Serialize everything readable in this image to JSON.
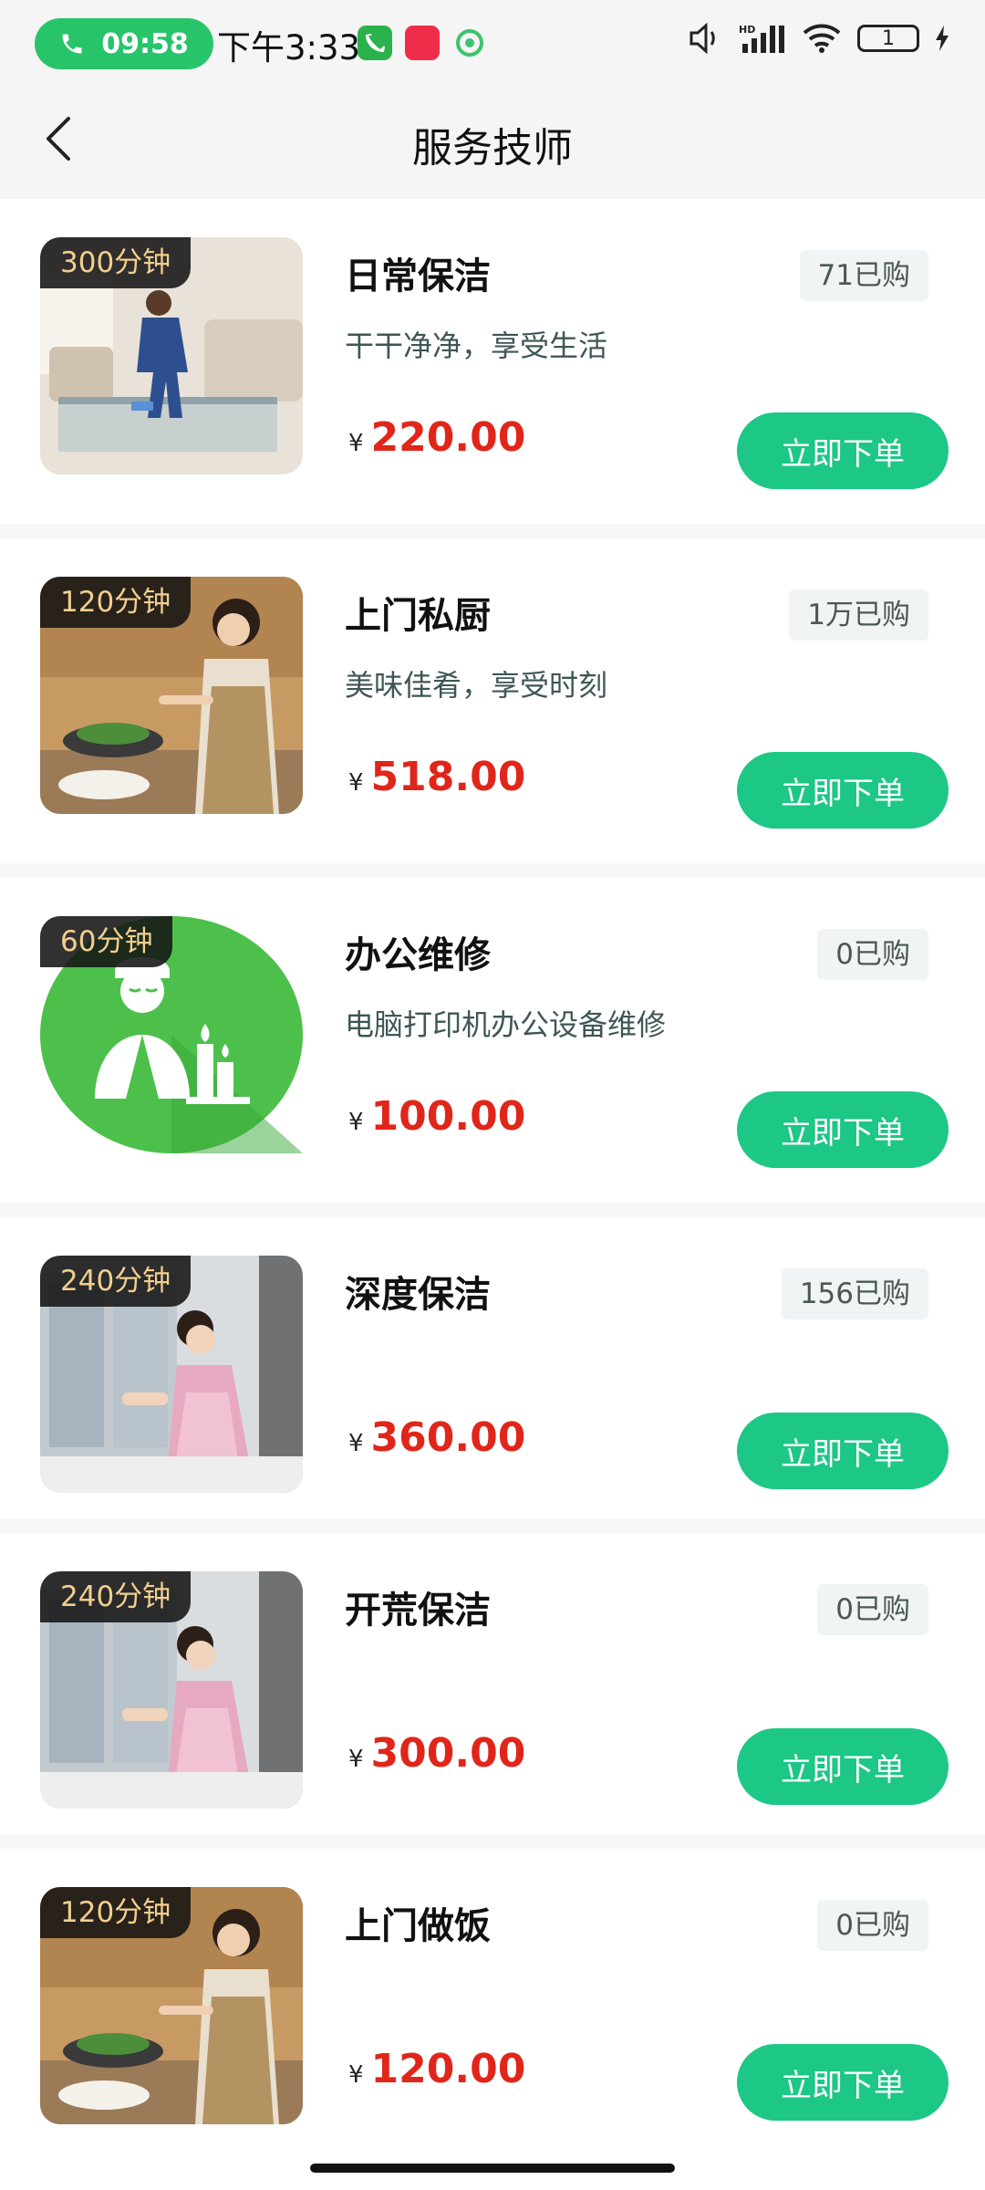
{
  "status_bar": {
    "call_time": "09:58",
    "clock": "下午3:33",
    "battery": "1",
    "network": "HD"
  },
  "header": {
    "title": "服务技师"
  },
  "currency_symbol": "¥",
  "items": [
    {
      "duration": "300分钟",
      "title": "日常保洁",
      "desc": "干干净净，享受生活",
      "sold": "71已购",
      "price": "220.00",
      "button": "立即下单",
      "image": "cleaning-photo"
    },
    {
      "duration": "120分钟",
      "title": "上门私厨",
      "desc": "美味佳肴，享受时刻",
      "sold": "1万已购",
      "price": "518.00",
      "button": "立即下单",
      "image": "cooking-photo"
    },
    {
      "duration": "60分钟",
      "title": "办公维修",
      "desc": "电脑打印机办公设备维修",
      "sold": "0已购",
      "price": "100.00",
      "button": "立即下单",
      "image": "spa-icon-green"
    },
    {
      "duration": "240分钟",
      "title": "深度保洁",
      "desc": "",
      "sold": "156已购",
      "price": "360.00",
      "button": "立即下单",
      "image": "window-cleaning-photo"
    },
    {
      "duration": "240分钟",
      "title": "开荒保洁",
      "desc": "",
      "sold": "0已购",
      "price": "300.00",
      "button": "立即下单",
      "image": "window-cleaning-photo"
    },
    {
      "duration": "120分钟",
      "title": "上门做饭",
      "desc": "",
      "sold": "0已购",
      "price": "120.00",
      "button": "立即下单",
      "image": "cooking-photo"
    }
  ]
}
